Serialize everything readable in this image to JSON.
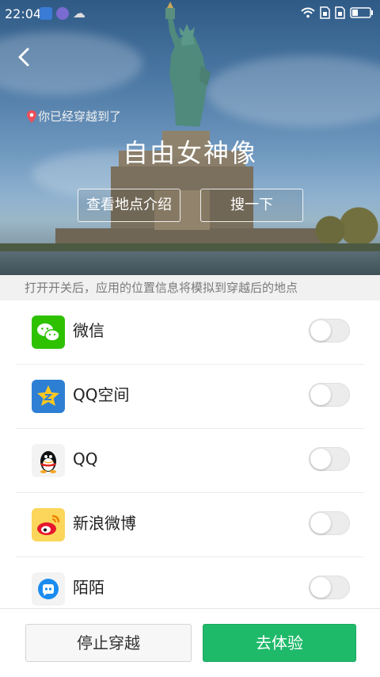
{
  "status_bar": {
    "time": "22:04"
  },
  "hero": {
    "here_label": "你已经穿越到了",
    "place_name": "自由女神像",
    "intro_button": "查看地点介绍",
    "search_button": "搜一下"
  },
  "hint": "打开开关后，应用的位置信息将模拟到穿越后的地点",
  "apps": [
    {
      "label": "微信",
      "icon": "wechat-icon",
      "enabled": false
    },
    {
      "label": "QQ空间",
      "icon": "qzone-icon",
      "enabled": false
    },
    {
      "label": "QQ",
      "icon": "qq-icon",
      "enabled": false
    },
    {
      "label": "新浪微博",
      "icon": "weibo-icon",
      "enabled": false
    },
    {
      "label": "陌陌",
      "icon": "momo-icon",
      "enabled": false
    }
  ],
  "footer": {
    "stop_label": "停止穿越",
    "go_label": "去体验"
  },
  "colors": {
    "accent_green": "#1fb96a",
    "pin_red": "#e8505b"
  }
}
